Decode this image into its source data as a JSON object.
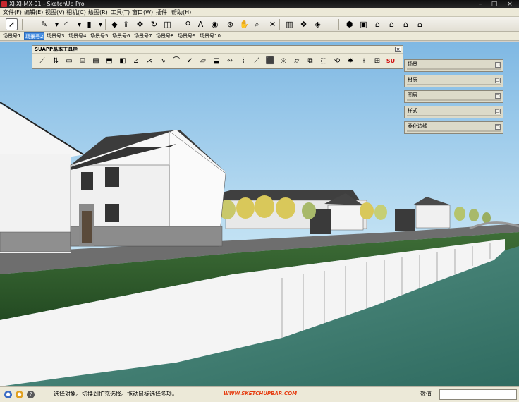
{
  "window": {
    "title": "XJ-XJ-MX-01 - SketchUp Pro",
    "controls": [
      "–",
      "□",
      "×"
    ]
  },
  "menubar": {
    "items": [
      {
        "label": "文件(F)"
      },
      {
        "label": "编辑(E)"
      },
      {
        "label": "视图(V)"
      },
      {
        "label": "相机(C)"
      },
      {
        "label": "绘图(R)"
      },
      {
        "label": "工具(T)"
      },
      {
        "label": "窗口(W)"
      },
      {
        "label": "插件"
      },
      {
        "label": "帮助(H)"
      }
    ]
  },
  "toolbar": {
    "tools": [
      {
        "name": "select-tool-button",
        "icon": "select-arrow-icon",
        "glyph": "➚"
      },
      {
        "name": "pencil-tool-button",
        "icon": "pencil-icon",
        "glyph": "✎"
      },
      {
        "name": "line-dropdown-button",
        "icon": "dropdown-arrow-icon",
        "glyph": "▾"
      },
      {
        "name": "arc-tool-button",
        "icon": "arc-icon",
        "glyph": "◜"
      },
      {
        "name": "arc-dropdown-button",
        "icon": "dropdown-arrow-icon",
        "glyph": "▾"
      },
      {
        "name": "shape-tool-button",
        "icon": "rectangle-icon",
        "glyph": "▮"
      },
      {
        "name": "shape-dropdown-button",
        "icon": "dropdown-arrow-icon",
        "glyph": "▾"
      },
      {
        "name": "paint-bucket-button",
        "icon": "paint-bucket-icon",
        "glyph": "◆"
      },
      {
        "name": "push-pull-button",
        "icon": "push-pull-icon",
        "glyph": "⇪"
      },
      {
        "name": "move-tool-button",
        "icon": "move-icon",
        "glyph": "✥"
      },
      {
        "name": "rotate-tool-button",
        "icon": "rotate-icon",
        "glyph": "↻"
      },
      {
        "name": "offset-tool-button",
        "icon": "offset-icon",
        "glyph": "◫"
      },
      {
        "name": "tape-measure-button",
        "icon": "tape-measure-icon",
        "glyph": "⚲"
      },
      {
        "name": "text-tool-button",
        "icon": "text-icon",
        "glyph": "A"
      },
      {
        "name": "paint-tool-button",
        "icon": "paint-icon",
        "glyph": "◉"
      },
      {
        "name": "orbit-tool-button",
        "icon": "orbit-icon",
        "glyph": "⊛"
      },
      {
        "name": "pan-tool-button",
        "icon": "pan-hand-icon",
        "glyph": "✋"
      },
      {
        "name": "zoom-tool-button",
        "icon": "zoom-icon",
        "glyph": "⌕"
      },
      {
        "name": "zoom-extents-button",
        "icon": "zoom-extents-icon",
        "glyph": "✕"
      },
      {
        "name": "model-info-button",
        "icon": "book-icon",
        "glyph": "▥"
      },
      {
        "name": "components-button",
        "icon": "components-icon",
        "glyph": "❖"
      },
      {
        "name": "materials-button",
        "icon": "materials-icon",
        "glyph": "◈"
      },
      {
        "name": "iso-view-button",
        "icon": "iso-view-icon",
        "glyph": "⬢"
      },
      {
        "name": "top-view-button",
        "icon": "top-view-icon",
        "glyph": "▣"
      },
      {
        "name": "front-view-button",
        "icon": "front-view-icon",
        "glyph": "⌂"
      },
      {
        "name": "right-view-button",
        "icon": "right-view-icon",
        "glyph": "⌂"
      },
      {
        "name": "back-view-button",
        "icon": "back-view-icon",
        "glyph": "⌂"
      },
      {
        "name": "left-view-button",
        "icon": "left-view-icon",
        "glyph": "⌂"
      }
    ]
  },
  "scene_tabs": {
    "tabs": [
      {
        "label": "场景号1",
        "active": false
      },
      {
        "label": "场景号2",
        "active": true
      },
      {
        "label": "场景号3",
        "active": false
      },
      {
        "label": "场景号4",
        "active": false
      },
      {
        "label": "场景号5",
        "active": false
      },
      {
        "label": "场景号6",
        "active": false
      },
      {
        "label": "场景号7",
        "active": false
      },
      {
        "label": "场景号8",
        "active": false
      },
      {
        "label": "场景号9",
        "active": false
      },
      {
        "label": "场景号10",
        "active": false
      }
    ]
  },
  "suapp_palette": {
    "title": "SUAPP基本工具栏",
    "close": "×",
    "tools": [
      {
        "name": "wall-tool",
        "glyph": "⟋"
      },
      {
        "name": "window-tool",
        "glyph": "⇅"
      },
      {
        "name": "door-tool",
        "glyph": "▭"
      },
      {
        "name": "stair-tool",
        "glyph": "⌸"
      },
      {
        "name": "railing-tool",
        "glyph": "▤"
      },
      {
        "name": "roof-tool",
        "glyph": "⬒"
      },
      {
        "name": "glass-tool",
        "glyph": "◧"
      },
      {
        "name": "axis-tool",
        "glyph": "⊿"
      },
      {
        "name": "line-edit-tool",
        "glyph": "⋌"
      },
      {
        "name": "curve-tool",
        "glyph": "∿"
      },
      {
        "name": "fillet-tool",
        "glyph": "⌒"
      },
      {
        "name": "check-tool",
        "glyph": "✔"
      },
      {
        "name": "face-tool",
        "glyph": "▱"
      },
      {
        "name": "layer-tool",
        "glyph": "⬓"
      },
      {
        "name": "spline-tool",
        "glyph": "∾"
      },
      {
        "name": "weld-tool",
        "glyph": "⌇"
      },
      {
        "name": "knife-tool",
        "glyph": "⟋"
      },
      {
        "name": "box-tool",
        "glyph": "⬛"
      },
      {
        "name": "shell-tool",
        "glyph": "◎"
      },
      {
        "name": "cylinder-tool",
        "glyph": "⌭"
      },
      {
        "name": "group-tool",
        "glyph": "⧉"
      },
      {
        "name": "frame-tool",
        "glyph": "⬚"
      },
      {
        "name": "rotate-copy-tool",
        "glyph": "⟲"
      },
      {
        "name": "explode-tool",
        "glyph": "✸"
      },
      {
        "name": "pipe-tool",
        "glyph": "⟊"
      },
      {
        "name": "grid-tool",
        "glyph": "⊞"
      },
      {
        "name": "suapp-logo-tool",
        "glyph": "SU"
      }
    ]
  },
  "tray_panels": [
    {
      "name": "tray-scenes",
      "label": "场景",
      "btn": "□"
    },
    {
      "name": "tray-materials",
      "label": "材质",
      "btn": "□"
    },
    {
      "name": "tray-layers",
      "label": "图层",
      "btn": "□"
    },
    {
      "name": "tray-styles",
      "label": "样式",
      "btn": "□"
    },
    {
      "name": "tray-soften-edges",
      "label": "柔化边线",
      "btn": "□"
    }
  ],
  "statusbar": {
    "text": "选择对象。切换到扩充选择。拖动鼠标选择多项。",
    "logo": "WWW.SKETCHUPBAR.COM",
    "measure_label": "数值",
    "measure_value": ""
  },
  "colors": {
    "sky_top": "#8fc3e8",
    "sky_bottom": "#d4ecf8",
    "grass": "#2d5a2a",
    "water": "#4f8a7c",
    "road": "#5a5a5a",
    "wall": "#f2f2f2",
    "roof": "#4a4a4a",
    "stone": "#8c8c8c",
    "scene_tab_active": "#4a90e2"
  }
}
